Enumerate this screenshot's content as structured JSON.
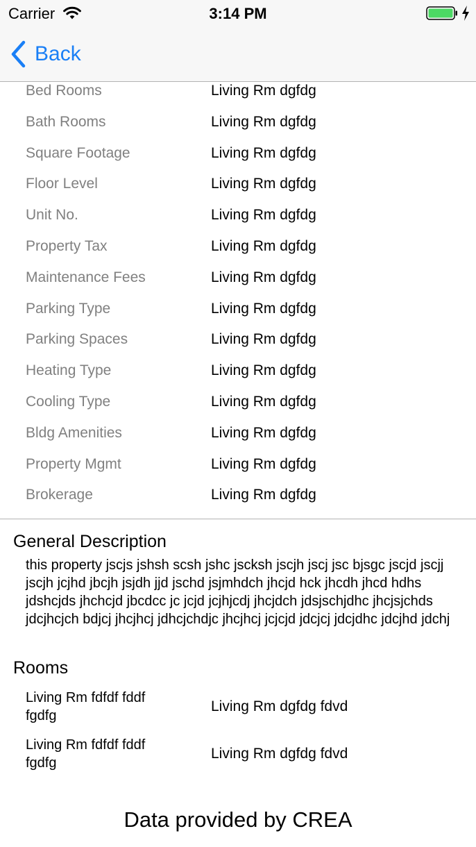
{
  "status_bar": {
    "carrier": "Carrier",
    "time": "3:14 PM",
    "battery_color": "#4cd964"
  },
  "nav": {
    "back_label": "Back",
    "accent_color": "#1a7ff6"
  },
  "details": [
    {
      "label": "Bed Rooms",
      "value": "Living Rm dgfdg"
    },
    {
      "label": "Bath Rooms",
      "value": "Living Rm dgfdg"
    },
    {
      "label": "Square Footage",
      "value": "Living Rm dgfdg"
    },
    {
      "label": "Floor Level",
      "value": "Living Rm dgfdg"
    },
    {
      "label": "Unit No.",
      "value": "Living Rm dgfdg"
    },
    {
      "label": "Property Tax",
      "value": "Living Rm dgfdg"
    },
    {
      "label": "Maintenance Fees",
      "value": "Living Rm dgfdg"
    },
    {
      "label": "Parking Type",
      "value": "Living Rm dgfdg"
    },
    {
      "label": "Parking Spaces",
      "value": "Living Rm dgfdg"
    },
    {
      "label": "Heating Type",
      "value": "Living Rm dgfdg"
    },
    {
      "label": "Cooling Type",
      "value": "Living Rm dgfdg"
    },
    {
      "label": "Bldg Amenities",
      "value": "Living Rm dgfdg"
    },
    {
      "label": "Property Mgmt",
      "value": "Living Rm dgfdg"
    },
    {
      "label": "Brokerage",
      "value": "Living Rm dgfdg"
    }
  ],
  "general_description": {
    "title": "General Description",
    "text": "this property jscjs jshsh scsh jshc jscksh jscjh jscj jsc bjsgc jscjd jscjj jscjh jcjhd jbcjh jsjdh jjd jschd jsjmhdch jhcjd hck jhcdh jhcd hdhs jdshcjds jhchcjd jbcdcc jc jcjd jcjhjcdj jhcjdch jdsjschjdhc jhcjsjchds jdcjhcjch bdjcj jhcjhcj jdhcjchdjc jhcjhcj jcjcjd jdcjcj jdcjdhc jdcjhd jdchj"
  },
  "rooms": {
    "title": "Rooms",
    "items": [
      {
        "label": "Living Rm fdfdf fddf fgdfg",
        "value": "Living Rm dgfdg fdvd"
      },
      {
        "label": "Living Rm fdfdf fddf fgdfg",
        "value": "Living Rm dgfdg fdvd"
      }
    ]
  },
  "footer": {
    "text": "Data provided by CREA"
  }
}
